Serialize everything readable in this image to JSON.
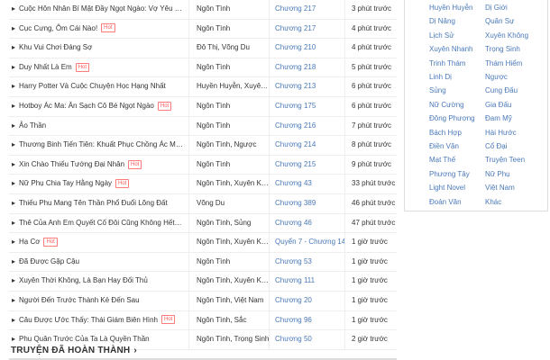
{
  "story_list": [
    {
      "title": "Cuộc Hôn Nhân Bí Mật Đầy Ngọt Ngào: Vợ Yêu Bé Bỏng",
      "hot": false,
      "genre": "Ngôn Tình",
      "chapter": "Chương 217",
      "time": "3 phút trước"
    },
    {
      "title": "Cục Cưng, Ôm Cái Nào!",
      "hot": true,
      "genre": "Ngôn Tình",
      "chapter": "Chương 217",
      "time": "4 phút trước"
    },
    {
      "title": "Khu Vui Chơi Đáng Sợ",
      "hot": false,
      "genre": "Đô Thị, Võng Du",
      "chapter": "Chương 210",
      "time": "4 phút trước"
    },
    {
      "title": "Duy Nhất Là Em",
      "hot": true,
      "genre": "Ngôn Tình",
      "chapter": "Chương 218",
      "time": "5 phút trước"
    },
    {
      "title": "Harry Potter Và Cuộc Chuyện Học Hạng Nhất",
      "hot": false,
      "genre": "Huyền Huyễn, Xuyên Không",
      "chapter": "Chương 213",
      "time": "6 phút trước"
    },
    {
      "title": "Hotboy Ác Ma: Ăn Sạch Cô Bé Ngọt Ngào",
      "hot": true,
      "genre": "Ngôn Tình",
      "chapter": "Chương 175",
      "time": "6 phút trước"
    },
    {
      "title": "Ảo Thần",
      "hot": false,
      "genre": "Ngôn Tình",
      "chapter": "Chương 216",
      "time": "7 phút trước"
    },
    {
      "title": "Thương Binh Tiến Tiên: Khuất Phục Chồng Ác Ma",
      "hot": true,
      "genre": "Ngôn Tình, Ngược",
      "chapter": "Chương 214",
      "time": "8 phút trước"
    },
    {
      "title": "Xin Chào Thiếu Tướng Đại Nhân",
      "hot": true,
      "genre": "Ngôn Tình",
      "chapter": "Chương 215",
      "time": "9 phút trước"
    },
    {
      "title": "Nữ Phụ Chia Tay Hằng Ngày",
      "hot": true,
      "genre": "Ngôn Tình, Xuyên Không",
      "chapter": "Chương 43",
      "time": "33 phút trước"
    },
    {
      "title": "Thiếu Phu Mang Tên Thần Phổ Đuổi Lõng Đất",
      "hot": false,
      "genre": "Võng Du",
      "chapter": "Chương 389",
      "time": "46 phút trước"
    },
    {
      "title": "Thê Của Anh Em Quyết Cố Đôi Cũng Không Hết",
      "hot": true,
      "genre": "Ngôn Tình, Sủng",
      "chapter": "Chương 46",
      "time": "47 phút trước"
    },
    {
      "title": "Hạ Cơ",
      "hot": true,
      "genre": "Ngôn Tình, Xuyên Không",
      "chapter": "Quyển 7 - Chương 14",
      "time": "1 giờ trước"
    },
    {
      "title": "Đã Được Gặp Cậu",
      "hot": false,
      "genre": "Ngôn Tình",
      "chapter": "Chương 53",
      "time": "1 giờ trước"
    },
    {
      "title": "Xuyên Thời Không, Là Bạn Hay Đối Thủ",
      "hot": false,
      "genre": "Ngôn Tình, Xuyên Không",
      "chapter": "Chương 111",
      "time": "1 giờ trước"
    },
    {
      "title": "Người Đến Trước Thành Kẻ Đến Sau",
      "hot": false,
      "genre": "Ngôn Tình, Việt Nam",
      "chapter": "Chương 20",
      "time": "1 giờ trước"
    },
    {
      "title": "Câu Được Ước Thấy: Thái Giám Biên Hình",
      "hot": true,
      "genre": "Ngôn Tình, Sắc",
      "chapter": "Chương 96",
      "time": "1 giờ trước"
    },
    {
      "title": "Phu Quân Trước Của Ta Là Quyền Thần",
      "hot": false,
      "genre": "Ngôn Tình, Trọng Sinh",
      "chapter": "Chương 50",
      "time": "2 giờ trước"
    }
  ],
  "hot_label": "Hot",
  "genres": [
    [
      "Huyền Huyễn",
      "Dị Giới"
    ],
    [
      "Dị Năng",
      "Quân Sự"
    ],
    [
      "Lịch Sử",
      "Xuyên Không"
    ],
    [
      "Xuyên Nhanh",
      "Trọng Sinh"
    ],
    [
      "Trinh Thám",
      "Thám Hiểm"
    ],
    [
      "Linh Dị",
      "Ngược"
    ],
    [
      "Sủng",
      "Cung Đấu"
    ],
    [
      "Nữ Cường",
      "Gia Đấu"
    ],
    [
      "Đông Phương",
      "Đam Mỹ"
    ],
    [
      "Bách Hợp",
      "Hài Hước"
    ],
    [
      "Điền Văn",
      "Cổ Đại"
    ],
    [
      "Mạt Thế",
      "Truyện Teen"
    ],
    [
      "Phương Tây",
      "Nữ Phụ"
    ],
    [
      "Light Novel",
      "Việt Nam"
    ],
    [
      "Đoản Văn",
      "Khác"
    ]
  ],
  "completed_section": {
    "title": "TRUYỆN ĐÃ HOÀN THÀNH"
  },
  "colors": {
    "link": "#4a79b8",
    "hot_border": "#ff7a7a",
    "text": "#333333"
  }
}
